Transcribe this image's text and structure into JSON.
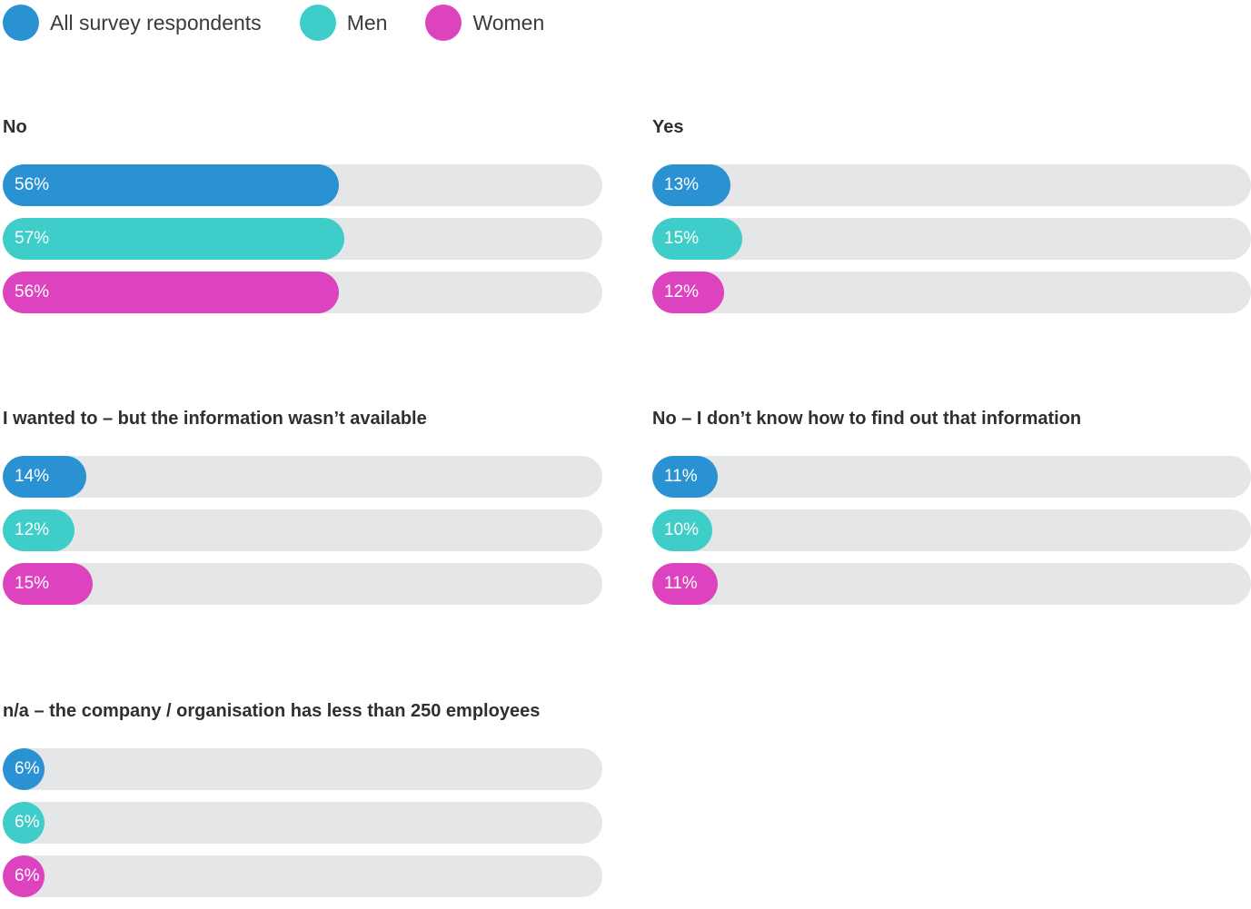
{
  "legend": [
    {
      "label": "All survey respondents",
      "color": "#2a92d2"
    },
    {
      "label": "Men",
      "color": "#3ecdc8"
    },
    {
      "label": "Women",
      "color": "#de43bf"
    }
  ],
  "track_color": "#e5e6e8",
  "chart_data": {
    "type": "bar",
    "orientation": "horizontal",
    "value_range": [
      0,
      100
    ],
    "unit": "%",
    "series_names": [
      "All survey respondents",
      "Men",
      "Women"
    ],
    "series_colors": [
      "#2a92d2",
      "#3ecdc8",
      "#de43bf"
    ],
    "legend_position": "top-left",
    "groups": [
      {
        "title": "No",
        "values": [
          56,
          57,
          56
        ],
        "labels": [
          "56%",
          "57%",
          "56%"
        ]
      },
      {
        "title": "Yes",
        "values": [
          13,
          15,
          12
        ],
        "labels": [
          "13%",
          "15%",
          "12%"
        ]
      },
      {
        "title": "I wanted to – but the information wasn’t available",
        "values": [
          14,
          12,
          15
        ],
        "labels": [
          "14%",
          "12%",
          "15%"
        ]
      },
      {
        "title": "No – I don’t know how to find out that information",
        "values": [
          11,
          10,
          11
        ],
        "labels": [
          "11%",
          "10%",
          "11%"
        ]
      },
      {
        "title": "n/a – the company / organisation has less than 250 employees",
        "values": [
          6,
          6,
          6
        ],
        "labels": [
          "6%",
          "6%",
          "6%"
        ]
      }
    ]
  }
}
